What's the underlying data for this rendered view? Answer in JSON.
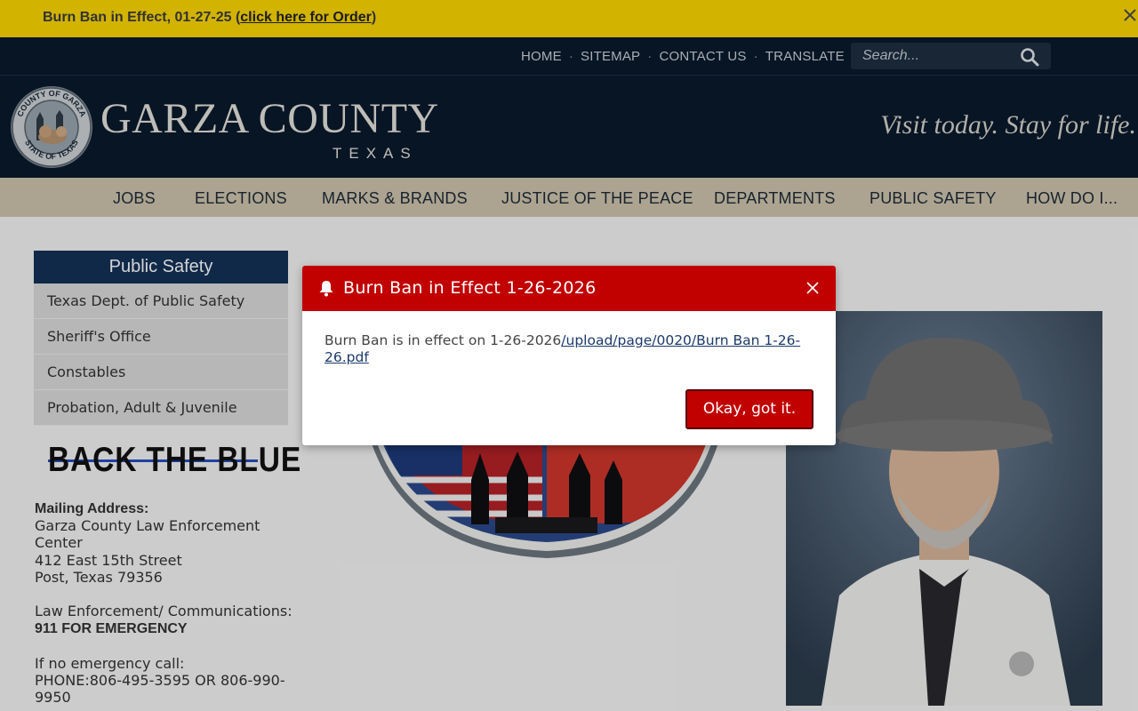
{
  "alert": {
    "text": "Burn Ban in Effect, 01-27-25 (",
    "link": "click here for Order",
    "suffix": ")"
  },
  "utility_nav": [
    "HOME",
    "SITEMAP",
    "CONTACT US",
    "TRANSLATE"
  ],
  "utility_separator": "·",
  "search": {
    "placeholder": "Search..."
  },
  "header": {
    "seal_text_top": "COUNTY OF GARZA",
    "seal_text_bottom": "STATE OF TEXAS",
    "county": "GARZA COUNTY",
    "state": "TEXAS",
    "tagline": "Visit today. Stay for life."
  },
  "nav": [
    "JOBS",
    "ELECTIONS",
    "MARKS & BRANDS",
    "JUSTICE OF THE PEACE",
    "DEPARTMENTS",
    "PUBLIC SAFETY",
    "HOW DO I..."
  ],
  "sidebar": {
    "title": "Public Safety",
    "items": [
      "Texas Dept. of Public Safety",
      "Sheriff's Office",
      "Constables",
      "Probation, Adult & Juvenile"
    ],
    "banner": "BACK THE BLUE"
  },
  "address": {
    "label": "Mailing Address:",
    "line1": "Garza County Law Enforcement Center",
    "line2": "412 East 15th Street",
    "line3": "Post, Texas  79356",
    "comm_label": "Law Enforcement/ Communications:",
    "emergency": "911 FOR EMERGENCY",
    "non_emergency_label": "If no emergency call:",
    "phone": "PHONE:806-495-3595 OR 806-990-9950"
  },
  "modal": {
    "title": "Burn Ban in Effect 1-26-2026",
    "body": "Burn Ban is in effect on 1-26-2026",
    "link": "/upload/page/0020/Burn Ban 1-26-26.pdf",
    "button": "Okay, got it."
  },
  "colors": {
    "alert": "#fcd800",
    "header": "#0a1a2c",
    "nav": "#cfc6ae",
    "sidebar_title": "#143258",
    "modal_accent": "#c10000"
  }
}
